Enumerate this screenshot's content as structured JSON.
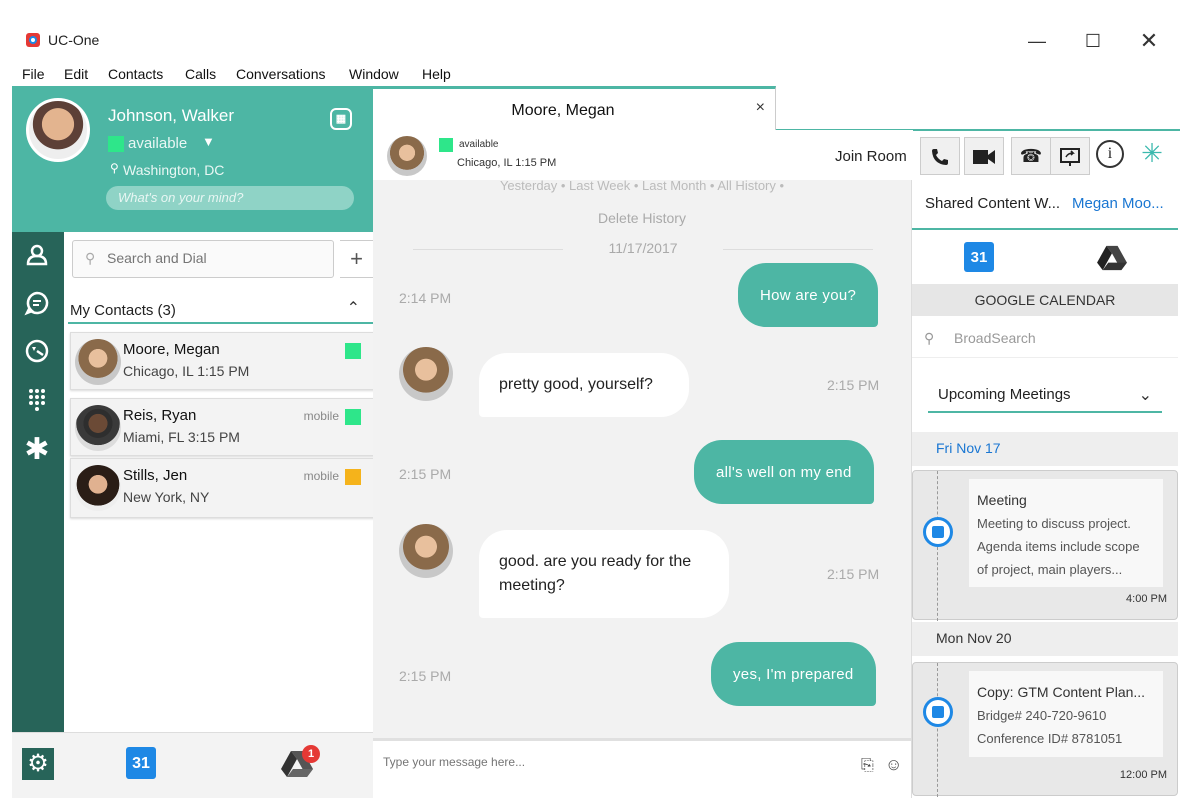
{
  "window": {
    "title": "UC-One",
    "minimize_glyph": "—",
    "maximize_glyph": "☐",
    "close_glyph": "✕"
  },
  "menu": [
    "File",
    "Edit",
    "Contacts",
    "Calls",
    "Conversations",
    "Window",
    "Help"
  ],
  "profile": {
    "name": "Johnson, Walker",
    "status": "available",
    "location": "Washington, DC",
    "mood_placeholder": "What's on your mind?"
  },
  "contacts": {
    "search_placeholder": "Search and Dial",
    "add_glyph": "+",
    "group_label": "My Contacts (3)",
    "items": [
      {
        "name": "Moore, Megan",
        "location": "Chicago, IL  1:15 PM",
        "device": "",
        "status_color": "#2ee68a"
      },
      {
        "name": "Reis, Ryan",
        "location": "Miami, FL  3:15 PM",
        "device": "mobile",
        "status_color": "#2ee68a"
      },
      {
        "name": "Stills, Jen",
        "location": "New York, NY",
        "device": "mobile",
        "status_color": "#f5b31b"
      }
    ]
  },
  "bottom_bar": {
    "calendar_label": "31",
    "drive_badge": "1"
  },
  "chat": {
    "tab_title": "Moore, Megan",
    "tab_close": "×",
    "contact_status": "available",
    "contact_location": "Chicago, IL 1:15 PM",
    "join_room": "Join Room",
    "history_filter": "Yesterday  •  Last Week  •  Last Month  •  All History  •",
    "delete_history": "Delete History",
    "date": "11/17/2017",
    "messages": [
      {
        "direction": "out",
        "text": "How are you?",
        "time": "2:14 PM"
      },
      {
        "direction": "in",
        "text": "pretty good, yourself?",
        "time": "2:15 PM"
      },
      {
        "direction": "out",
        "text": "all's well on my end",
        "time": "2:15 PM"
      },
      {
        "direction": "in",
        "text": "good. are you ready for the meeting?",
        "time": "2:15 PM"
      },
      {
        "direction": "out",
        "text": "yes, I'm prepared",
        "time": "2:15 PM"
      }
    ],
    "compose_placeholder": "Type your message here..."
  },
  "right_panel": {
    "tab_label": "Shared Content W...",
    "tab_sub": "Megan Moo...",
    "calendar_tab_label": "31",
    "section_title": "GOOGLE CALENDAR",
    "search_placeholder": "BroadSearch",
    "dropdown_value": "Upcoming Meetings",
    "days": [
      {
        "label": "Fri Nov 17",
        "title": "Meeting",
        "lines": [
          "Meeting to discuss project.",
          "Agenda items include scope",
          "of project, main players..."
        ],
        "time": "4:00 PM"
      },
      {
        "label": "Mon Nov 20",
        "title": "Copy: GTM Content Plan...",
        "lines": [
          "Bridge# 240-720-9610",
          "Conference ID# 8781051"
        ],
        "time": "12:00 PM"
      }
    ]
  },
  "colors": {
    "accent": "#4db6a4",
    "rail": "#276459",
    "available": "#2ee68a",
    "away": "#f5b31b",
    "link": "#1976d2"
  }
}
